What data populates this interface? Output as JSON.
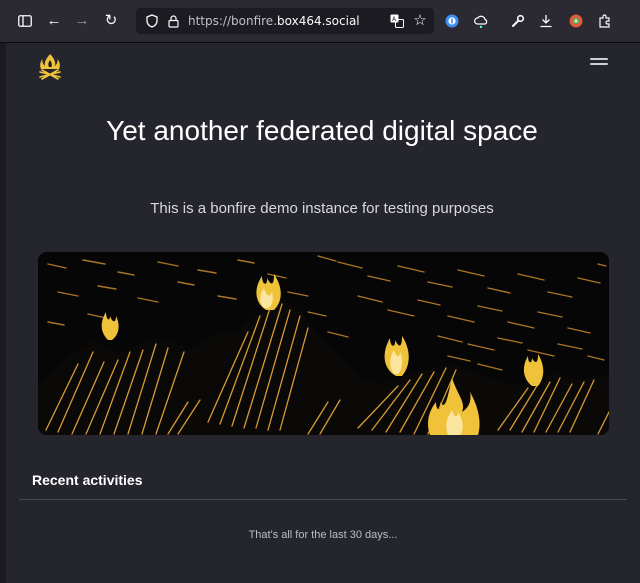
{
  "browser": {
    "url_prefix": "https://bonfire.",
    "url_domain": "box464.social",
    "icons": [
      "sidebar-icon",
      "back-icon",
      "forward-icon",
      "reload-icon",
      "shield-icon",
      "lock-icon",
      "translate-icon",
      "bookmark-star-icon",
      "password-manager-icon",
      "sync-icon",
      "tools-icon",
      "download-icon",
      "profile-icon",
      "extensions-icon"
    ]
  },
  "page": {
    "hero_title": "Yet another federated digital space",
    "hero_subtitle": "This is a bonfire demo instance for testing purposes",
    "recent_title": "Recent activities",
    "empty_message": "That's all for the last 30 days..."
  },
  "colors": {
    "page_bg": "#24252d",
    "fire": "#f0c23a",
    "ember": "#c98a2b"
  }
}
